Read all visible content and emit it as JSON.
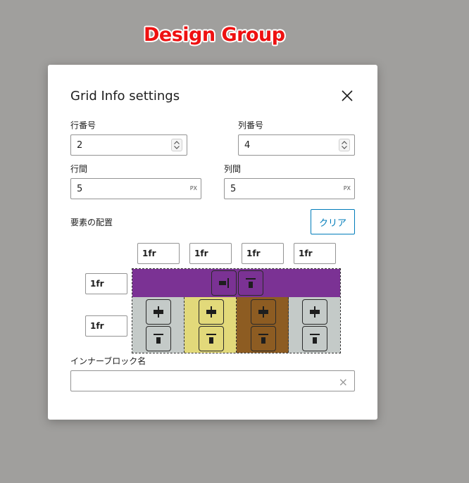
{
  "banner": "Design Group",
  "modal": {
    "title": "Grid Info settings",
    "rows": {
      "label": "行番号",
      "value": "2"
    },
    "cols": {
      "label": "列番号",
      "value": "4"
    },
    "row_gap": {
      "label": "行間",
      "value": "5",
      "unit": "PX"
    },
    "col_gap": {
      "label": "列間",
      "value": "5",
      "unit": "PX"
    },
    "placement_label": "要素の配置",
    "clear_label": "クリア",
    "col_sizes": [
      "1fr",
      "1fr",
      "1fr",
      "1fr"
    ],
    "row_sizes": [
      "1fr",
      "1fr"
    ],
    "inner_block_label": "インナーブロック名",
    "inner_block_value": "",
    "clear_symbol": "×"
  },
  "colors": {
    "row1": "#7b3294",
    "col_gray": "#c4cac8",
    "col_yellow": "#e2d97a",
    "col_brown": "#8d5c22"
  },
  "icons": [
    "close-icon",
    "spinner-icon",
    "align-right-icon",
    "align-top-icon",
    "align-center-icon",
    "clear-x-icon"
  ]
}
